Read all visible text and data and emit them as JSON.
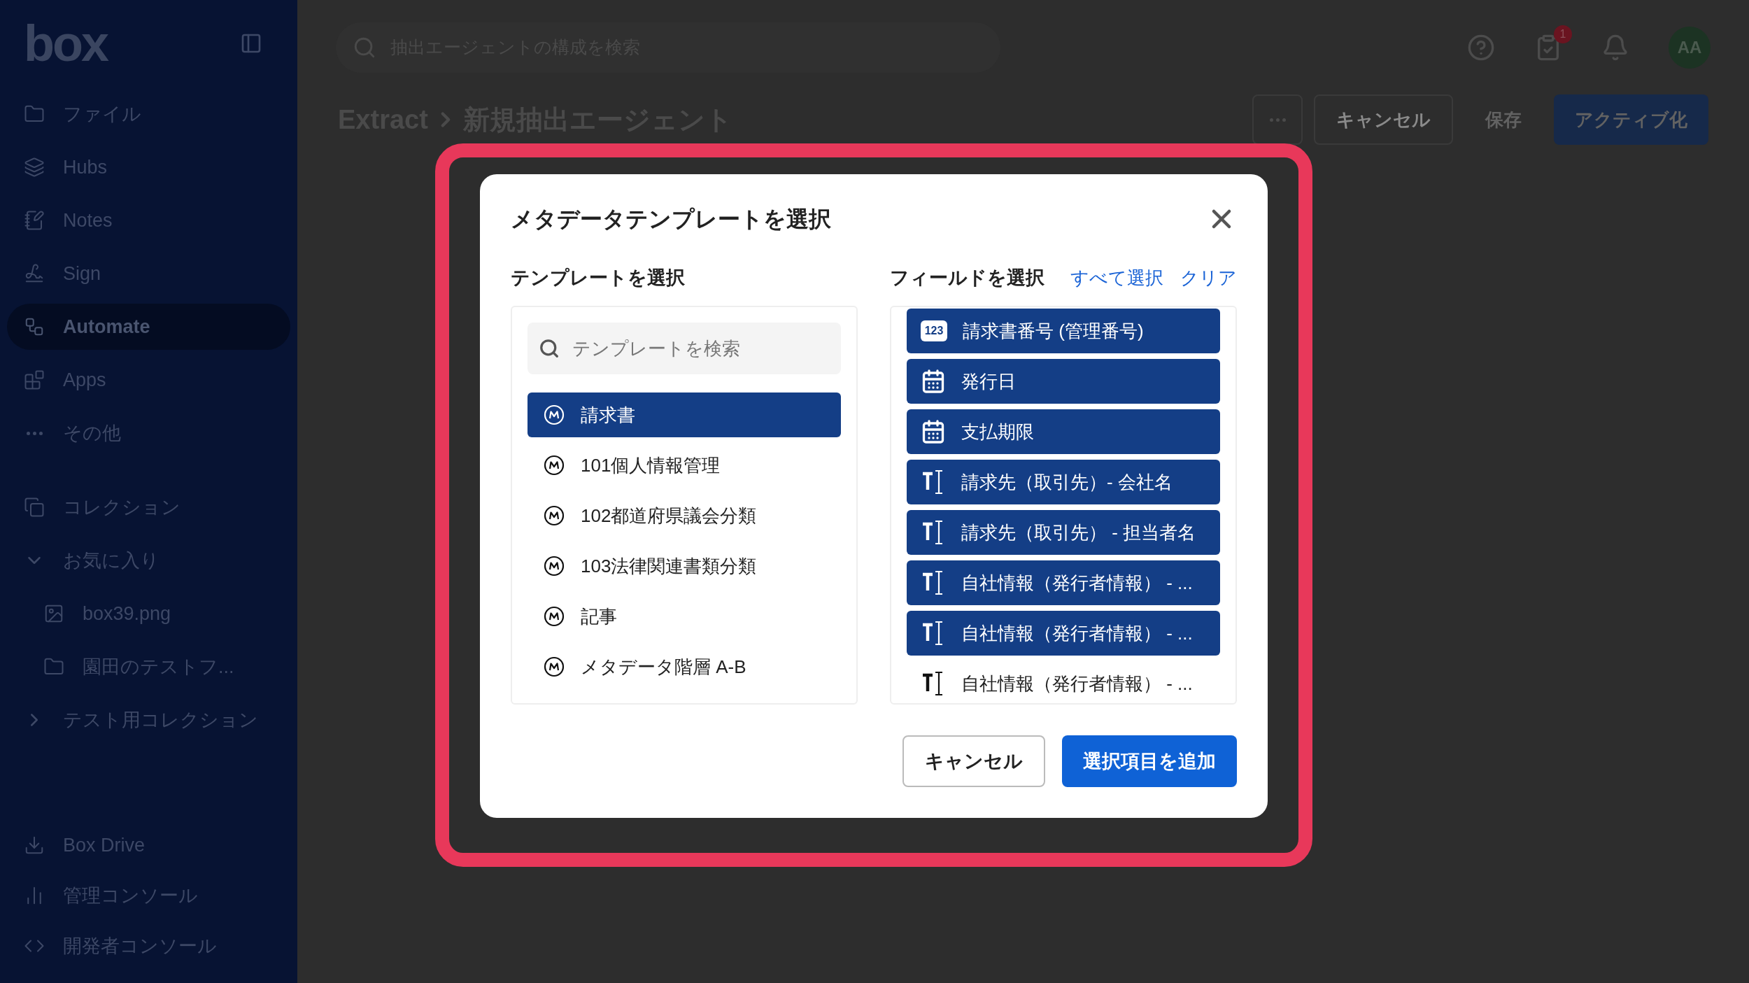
{
  "sidebar": {
    "logo": "box",
    "nav": [
      {
        "label": "ファイル",
        "selected": false
      },
      {
        "label": "Hubs",
        "selected": false
      },
      {
        "label": "Notes",
        "selected": false
      },
      {
        "label": "Sign",
        "selected": false
      },
      {
        "label": "Automate",
        "selected": true
      },
      {
        "label": "Apps",
        "selected": false
      },
      {
        "label": "その他",
        "selected": false
      }
    ],
    "collections": {
      "label": "コレクション",
      "groups": [
        {
          "label": "お気に入り",
          "expanded": true,
          "children": [
            {
              "label": "box39.png",
              "kind": "image"
            },
            {
              "label": "園田のテストフ...",
              "kind": "folder"
            }
          ]
        },
        {
          "label": "テスト用コレクション",
          "expanded": false
        }
      ]
    },
    "bottom": [
      {
        "label": "Box Drive"
      },
      {
        "label": "管理コンソール"
      },
      {
        "label": "開発者コンソール"
      }
    ]
  },
  "header": {
    "search_placeholder": "抽出エージェントの構成を検索",
    "tasks_badge": "1",
    "avatar": "AA"
  },
  "page": {
    "breadcrumb": [
      "Extract",
      "新規抽出エージェント"
    ],
    "actions": [
      {
        "label": "キャンセル",
        "kind": "outline",
        "disabled": false
      },
      {
        "label": "保存",
        "kind": "text",
        "disabled": true
      },
      {
        "label": "アクティブ化",
        "kind": "primary",
        "disabled": true
      }
    ]
  },
  "dialog": {
    "title": "メタデータテンプレートを選択",
    "templates": {
      "heading": "テンプレートを選択",
      "placeholder": "テンプレートを検索",
      "items": [
        {
          "label": "請求書",
          "selected": true
        },
        {
          "label": "101個人情報管理",
          "selected": false
        },
        {
          "label": "102都道府県議会分類",
          "selected": false
        },
        {
          "label": "103法律関連書類分類",
          "selected": false
        },
        {
          "label": "記事",
          "selected": false
        },
        {
          "label": "メタデータ階層 A-B",
          "selected": false
        }
      ]
    },
    "fields": {
      "heading": "フィールドを選択",
      "select_all": "すべて選択",
      "clear": "クリア",
      "items": [
        {
          "label": "請求書番号 (管理番号)",
          "kind": "number",
          "icon_label": "123",
          "selected": true
        },
        {
          "label": "発行日",
          "kind": "date",
          "selected": true
        },
        {
          "label": "支払期限",
          "kind": "date",
          "selected": true
        },
        {
          "label": "請求先（取引先）- 会社名",
          "kind": "text",
          "selected": true
        },
        {
          "label": "請求先（取引先） - 担当者名",
          "kind": "text",
          "selected": true
        },
        {
          "label": "自社情報（発行者情報） - ...",
          "kind": "text",
          "selected": true
        },
        {
          "label": "自社情報（発行者情報） - ...",
          "kind": "text",
          "selected": true
        },
        {
          "label": "自社情報（発行者情報） - ...",
          "kind": "text",
          "selected": false
        }
      ]
    },
    "buttons": [
      {
        "label": "キャンセル",
        "kind": "outline"
      },
      {
        "label": "選択項目を追加",
        "kind": "primary"
      }
    ]
  }
}
